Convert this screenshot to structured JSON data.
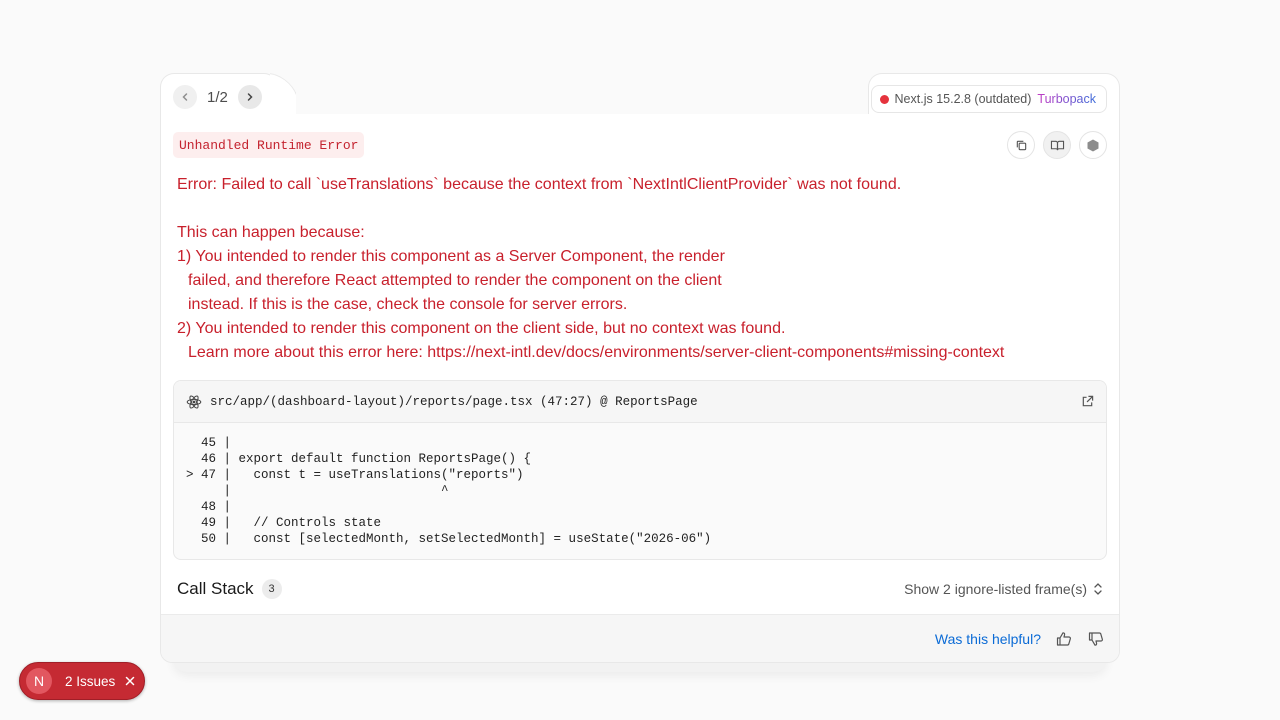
{
  "pager": {
    "current": "1/2",
    "prev_icon": "chevron-left-icon",
    "next_icon": "chevron-right-icon"
  },
  "version": {
    "framework": "Next.js 15.2.8 (outdated)",
    "bundler": "Turbopack",
    "status_color": "#e5333d"
  },
  "error": {
    "type": "Unhandled Runtime Error",
    "message_lines": [
      "Error: Failed to call `useTranslations` because the context from `NextIntlClientProvider` was not found.",
      "This can happen because:",
      "1) You intended to render this component as a Server Component, the render",
      "failed, and therefore React attempted to render the component on the client",
      "instead. If this is the case, check the console for server errors.",
      "2) You intended to render this component on the client side, but no context was found.",
      "Learn more about this error here: https://next-intl.dev/docs/environments/server-client-components#missing-context"
    ]
  },
  "toolbar": {
    "copy_icon": "copy-icon",
    "docs_icon": "book-icon",
    "inspect_icon": "node-icon"
  },
  "codeframe": {
    "file": "src/app/(dashboard-layout)/reports/page.tsx (47:27) @ ReportsPage",
    "lines": [
      "  45 |",
      "  46 | export default function ReportsPage() {",
      "> 47 |   const t = useTranslations(\"reports\")",
      "     |                            ^",
      "  48 |",
      "  49 |   // Controls state",
      "  50 |   const [selectedMonth, setSelectedMonth] = useState(\"2026-06\")"
    ]
  },
  "callstack": {
    "title": "Call Stack",
    "count": "3",
    "toggle_label": "Show 2 ignore-listed frame(s)"
  },
  "footer": {
    "helpful_label": "Was this helpful?"
  },
  "issues": {
    "logo_letter": "N",
    "label": "2 Issues",
    "accent": "#c52a33"
  }
}
